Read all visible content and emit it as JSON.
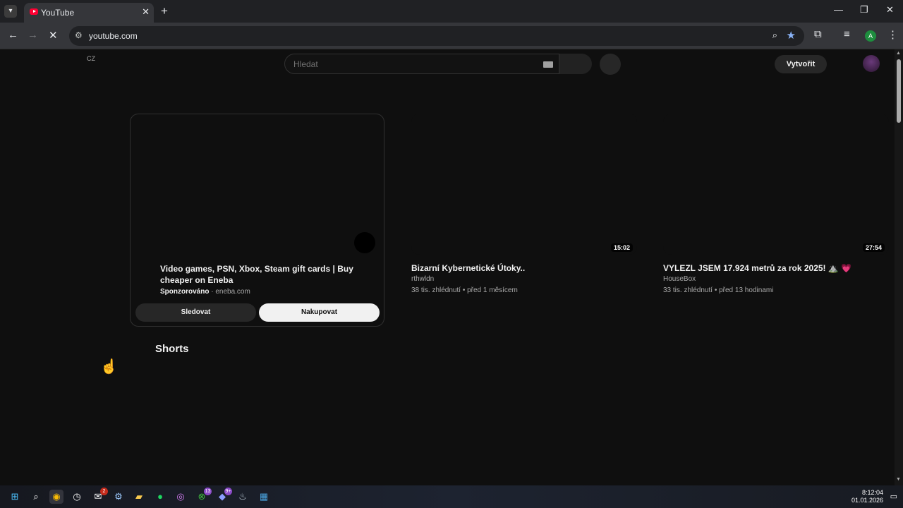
{
  "browser": {
    "tab_title": "YouTube",
    "tab_close": "✕",
    "new_tab": "+",
    "url": "youtube.com",
    "profile_initial": "A",
    "window_controls": [
      "—",
      "❐",
      "✕"
    ]
  },
  "youtube": {
    "country_code": "CZ",
    "search_placeholder": "Hledat",
    "create_label": "Vytvořit",
    "ad": {
      "title": "Video games, PSN, Xbox, Steam gift cards | Buy cheaper on Eneba",
      "sponsored_label": "Sponzorováno",
      "separator": " · ",
      "domain": "eneba.com",
      "follow_label": "Sledovat",
      "shop_label": "Nakupovat"
    },
    "videos": [
      {
        "duration": "15:02",
        "title": "Bizarní Kybernetické Útoky..",
        "channel": "rthwldn",
        "stats": "38 tis. zhlédnutí • před 1 měsícem"
      },
      {
        "duration": "27:54",
        "title": "VYLEZL JSEM 17.924 metrů za rok 2025! ⛰️ 💗",
        "channel": "HouseBox",
        "stats": "33 tis. zhlédnutí • před 13 hodinami"
      }
    ],
    "shorts_heading": "Shorts"
  },
  "taskbar": {
    "icons": [
      "windows-start",
      "search",
      "chrome",
      "timer",
      "notifications-app",
      "settings",
      "file-explorer",
      "spotify",
      "instagram",
      "xbox",
      "discord",
      "steam",
      "photos"
    ],
    "badges": {
      "notifications_app": "2",
      "xbox": "13",
      "discord": "9+"
    },
    "time": "8:12:04",
    "date": "01.01.2026"
  },
  "colors": {
    "youtube_red": "#ff0033",
    "page_bg": "#0f0f0f",
    "accent_blue": "#8ab4f8"
  }
}
